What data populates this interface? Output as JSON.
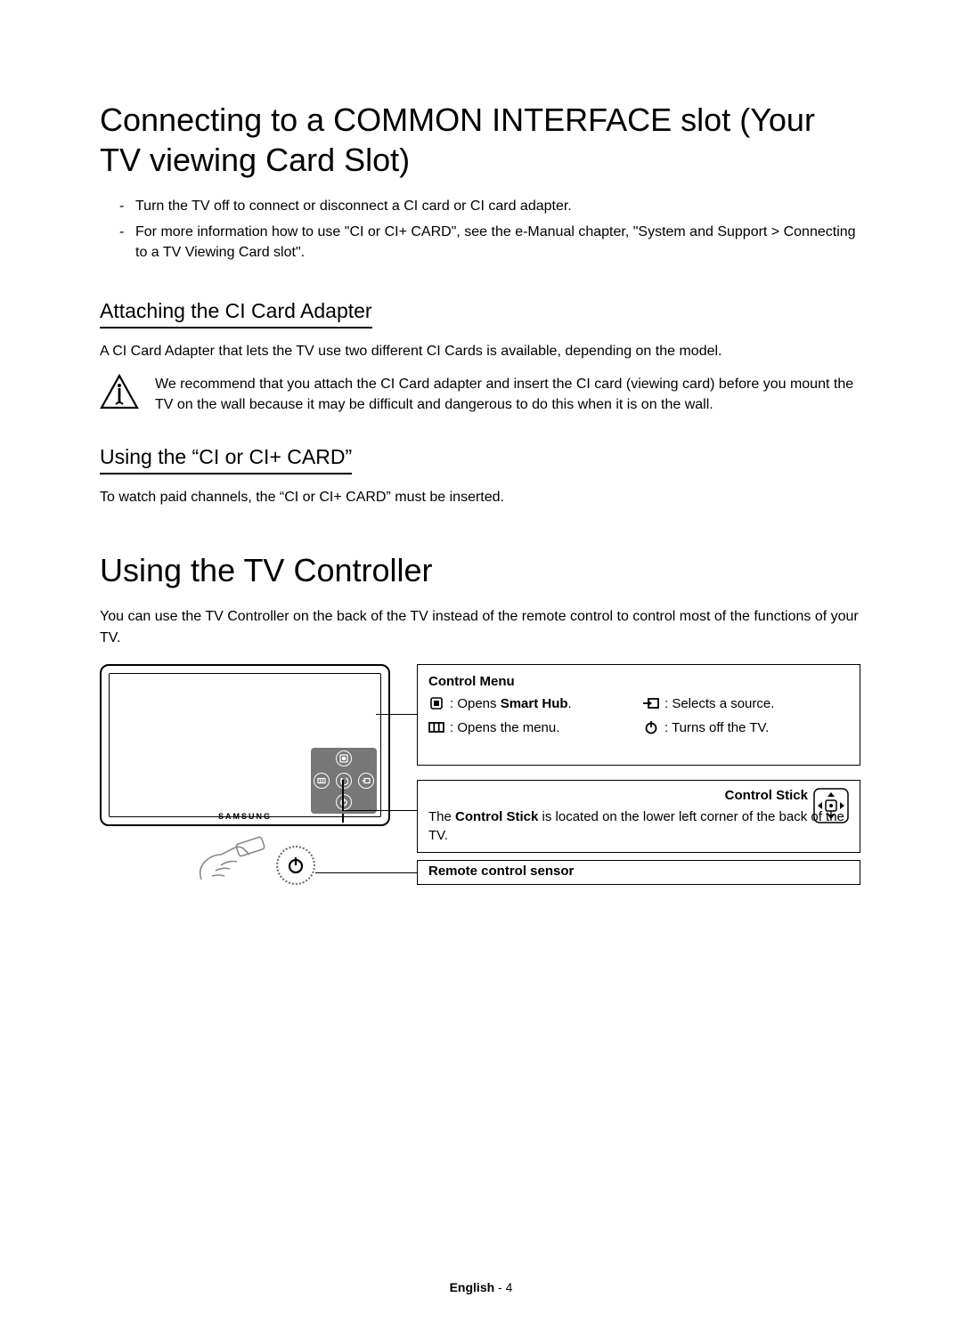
{
  "h1_a": "Connecting to a COMMON INTERFACE slot (Your TV viewing Card Slot)",
  "bullets": [
    "Turn the TV off to connect or disconnect a CI card or CI card adapter.",
    "For more information how to use \"CI or CI+ CARD\", see the e-Manual chapter, \"System and Support > Connecting to a TV Viewing Card slot\"."
  ],
  "h2_a": "Attaching the CI Card Adapter",
  "p_a": "A CI Card Adapter that lets the TV use two different CI Cards is available, depending on the model.",
  "note_a": "We recommend that you attach the CI Card adapter and insert the CI card (viewing card) before you mount the TV on the wall because it may be difficult and dangerous to do this when it is on the wall.",
  "h2_b": "Using the “CI or CI+ CARD”",
  "p_b": "To watch paid channels, the “CI or CI+ CARD” must be inserted.",
  "h1_b": "Using the TV Controller",
  "p_c": "You can use the TV Controller on the back of the TV instead of the remote control to control most of the functions of your TV.",
  "samsung": "SAMSUNG",
  "control_menu": {
    "title": "Control Menu",
    "smarthub_prefix": ": Opens ",
    "smarthub_bold": "Smart Hub",
    "smarthub_suffix": ".",
    "source": ": Selects a source.",
    "menu": ": Opens the menu.",
    "power": ": Turns off the TV."
  },
  "control_stick": {
    "title": "Control Stick",
    "text_prefix": "The ",
    "text_bold": "Control Stick",
    "text_suffix": " is located on the lower left corner of the back of the TV."
  },
  "remote_sensor": "Remote control sensor",
  "footer_lang": "English",
  "footer_sep": " - ",
  "footer_page": "4"
}
